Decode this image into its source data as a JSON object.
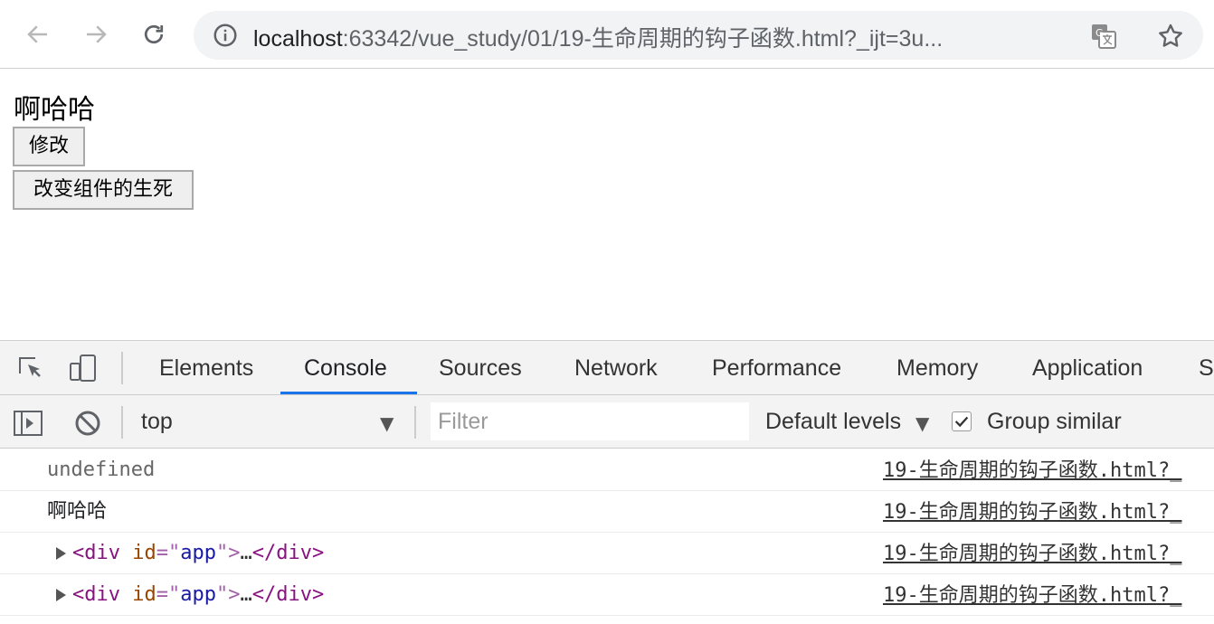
{
  "browser": {
    "url_host": "localhost",
    "url_rest": ":63342/vue_study/01/19-生命周期的钩子函数.html?_ijt=3u..."
  },
  "page": {
    "message": "啊哈哈",
    "buttons": {
      "modify": "修改",
      "toggle_life": "改变组件的生死"
    }
  },
  "devtools": {
    "tabs": [
      "Elements",
      "Console",
      "Sources",
      "Network",
      "Performance",
      "Memory",
      "Application",
      "S"
    ],
    "active_tab": "Console",
    "context": "top",
    "filter_placeholder": "Filter",
    "levels": "Default levels",
    "group_similar": "Group similar",
    "group_similar_checked": true,
    "accent_color": "#1a73e8"
  },
  "console": {
    "rows": [
      {
        "type": "value",
        "text": "undefined",
        "source": "19-生命周期的钩子函数.html?_"
      },
      {
        "type": "log",
        "text": "啊哈哈",
        "source": "19-生命周期的钩子函数.html?_"
      },
      {
        "type": "element",
        "tag_open": "<div",
        "attr_name": "id",
        "attr_eq": "=\"",
        "attr_value": "app",
        "attr_close": "\">",
        "ellipsis": "…",
        "tag_close": "</div>",
        "source": "19-生命周期的钩子函数.html?_"
      },
      {
        "type": "element",
        "tag_open": "<div",
        "attr_name": "id",
        "attr_eq": "=\"",
        "attr_value": "app",
        "attr_close": "\">",
        "ellipsis": "…",
        "tag_close": "</div>",
        "source": "19-生命周期的钩子函数.html?_"
      }
    ]
  }
}
